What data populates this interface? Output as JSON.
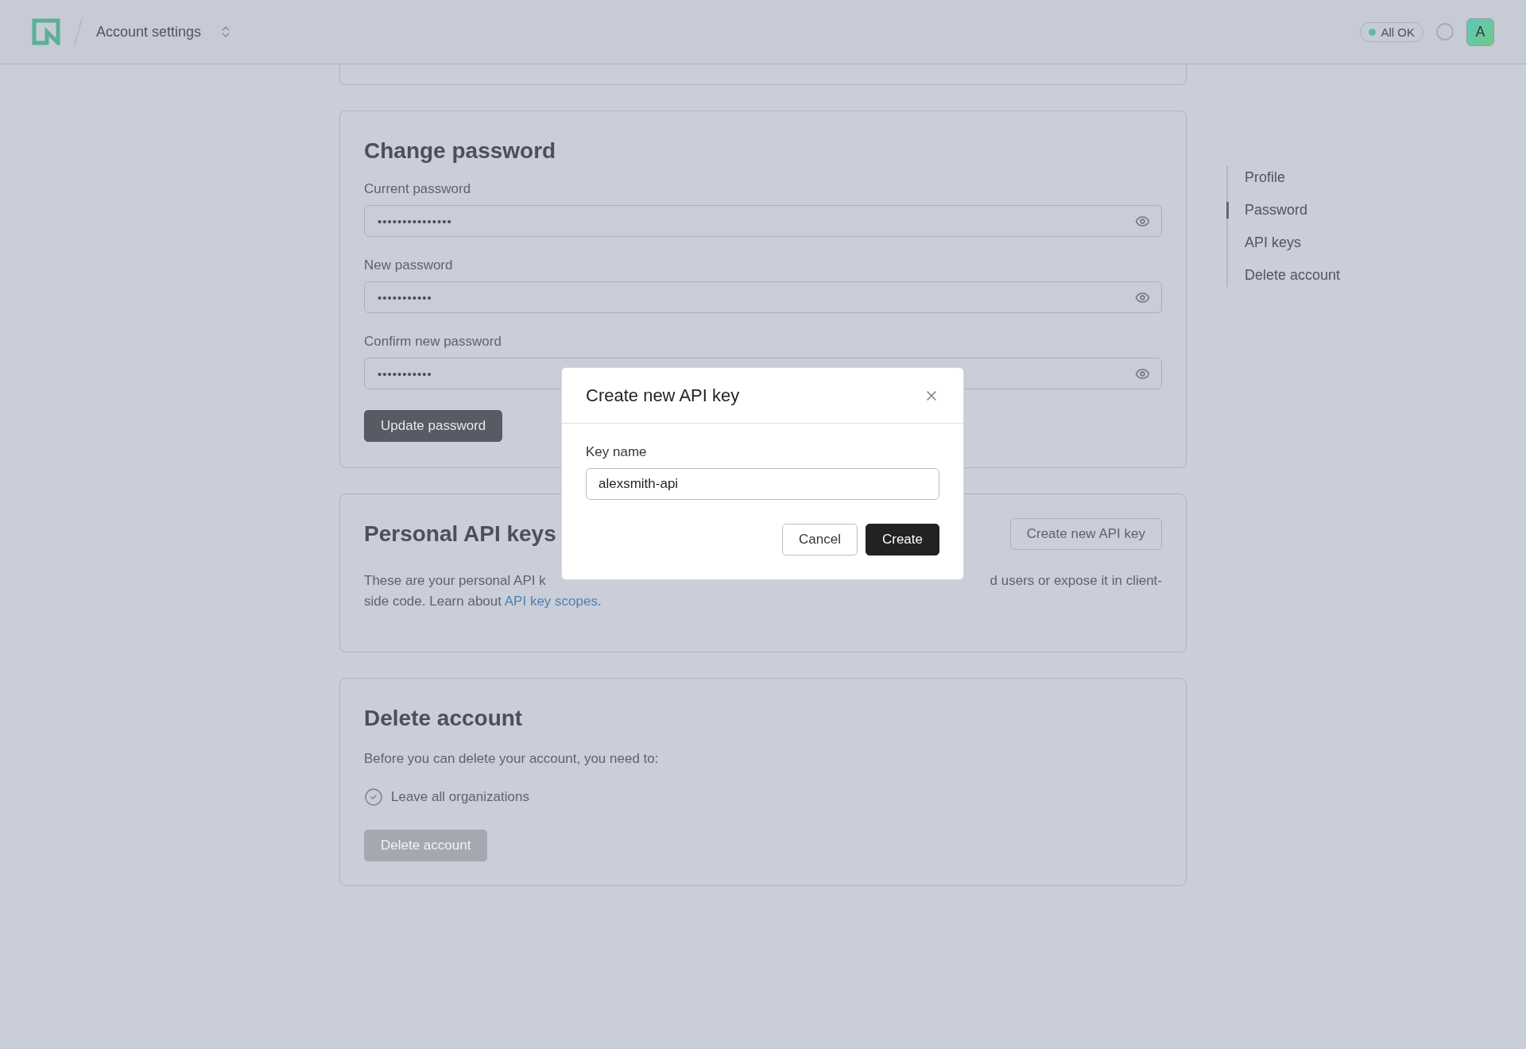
{
  "header": {
    "breadcrumb": "Account settings",
    "status": {
      "label": "All OK",
      "color": "#5cbf9f"
    },
    "avatar": "A"
  },
  "sections": [
    {
      "kind": "stub"
    },
    {
      "kind": "password",
      "title": "Change password",
      "fields": [
        {
          "label": "Current password",
          "value": "•••••••••••••••"
        },
        {
          "label": "New password",
          "value": "•••••••••••"
        },
        {
          "label": "Confirm new password",
          "value": "•••••••••••"
        }
      ],
      "button": "Update password"
    },
    {
      "kind": "api",
      "title": "Personal API keys",
      "button": "Create new API key",
      "text_left": "These are your personal API k",
      "text_right": "d users or expose it in client-",
      "text_line2": "side code. Learn about",
      "link": "API key scopes",
      "text_end": "."
    },
    {
      "kind": "delete",
      "title": "Delete account",
      "text": "Before you can delete your account, you need to:",
      "requirements": [
        {
          "label": "Leave all organizations",
          "checked": true
        }
      ],
      "button": "Delete account",
      "button_disabled": true
    }
  ],
  "toc": [
    {
      "label": "Profile",
      "selected": false
    },
    {
      "label": "Password",
      "selected": true
    },
    {
      "label": "API keys",
      "selected": false
    },
    {
      "label": "Delete account",
      "selected": false
    }
  ],
  "modal": {
    "title": "Create new API key",
    "field_label": "Key name",
    "value": "alexsmith-api",
    "buttons": [
      {
        "label": "Cancel",
        "kind": "secondary"
      },
      {
        "label": "Create",
        "kind": "primary"
      }
    ]
  }
}
